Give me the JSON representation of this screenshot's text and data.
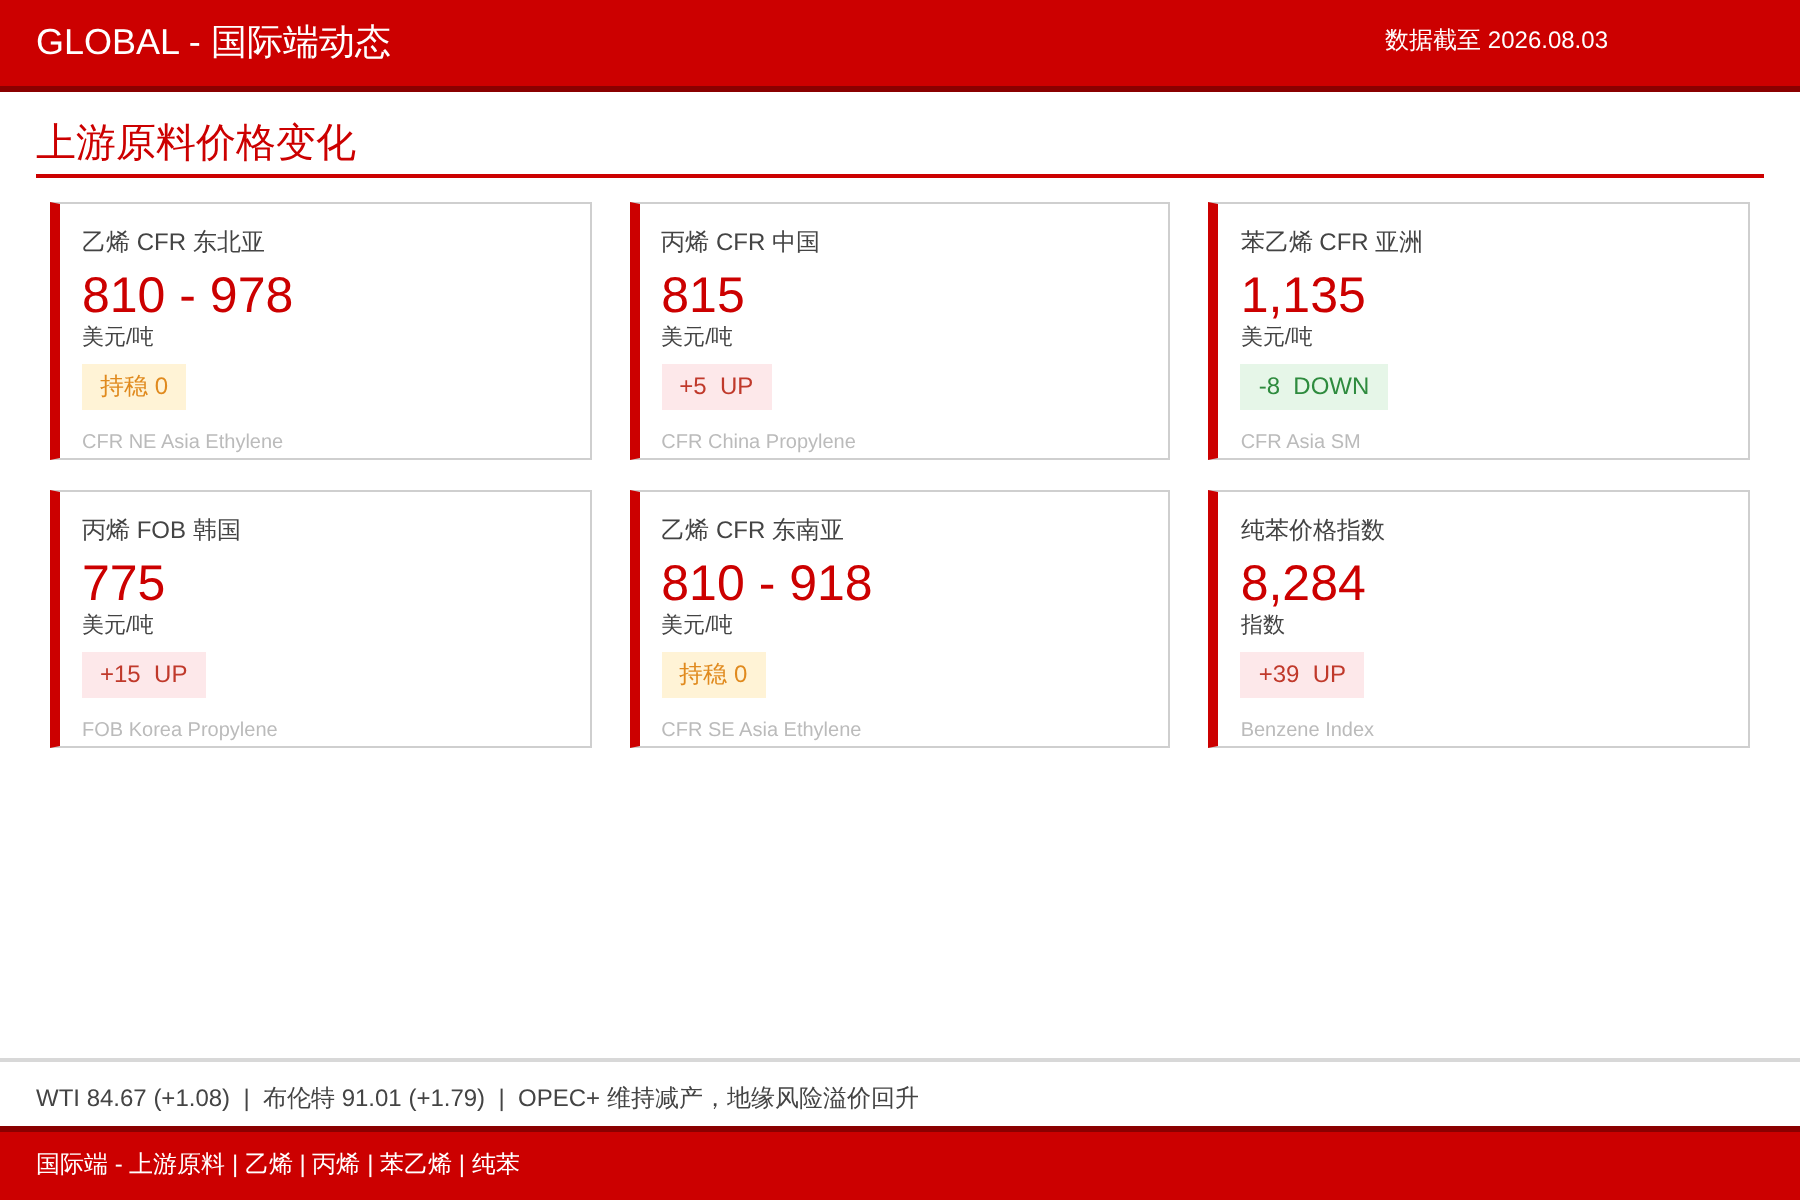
{
  "header": {
    "title": "GLOBAL - 国际端动态",
    "date": "数据截至 2026.08.03"
  },
  "section": {
    "title": "上游原料价格变化"
  },
  "cards": [
    {
      "name": "乙烯 CFR 东北亚",
      "price": "810 - 978",
      "unit": "美元/吨",
      "change": "持稳 0",
      "kind": "flat",
      "english": "CFR NE Asia Ethylene"
    },
    {
      "name": "丙烯 CFR 中国",
      "price": "815",
      "unit": "美元/吨",
      "change": "+5  UP",
      "kind": "up",
      "english": "CFR China Propylene"
    },
    {
      "name": "苯乙烯 CFR 亚洲",
      "price": "1,135",
      "unit": "美元/吨",
      "change": "-8  DOWN",
      "kind": "down",
      "english": "CFR Asia SM"
    },
    {
      "name": "丙烯 FOB 韩国",
      "price": "775",
      "unit": "美元/吨",
      "change": "+15  UP",
      "kind": "up",
      "english": "FOB Korea Propylene"
    },
    {
      "name": "乙烯 CFR 东南亚",
      "price": "810 - 918",
      "unit": "美元/吨",
      "change": "持稳 0",
      "kind": "flat",
      "english": "CFR SE Asia Ethylene"
    },
    {
      "name": "纯苯价格指数",
      "price": "8,284",
      "unit": "指数",
      "change": "+39  UP",
      "kind": "up",
      "english": "Benzene Index"
    }
  ],
  "ticker": "WTI 84.67 (+1.08)  |  布伦特 91.01 (+1.79)  |  OPEC+ 维持减产，地缘风险溢价回升",
  "footer": "国际端 - 上游原料 | 乙烯 | 丙烯 | 苯乙烯 | 纯苯"
}
